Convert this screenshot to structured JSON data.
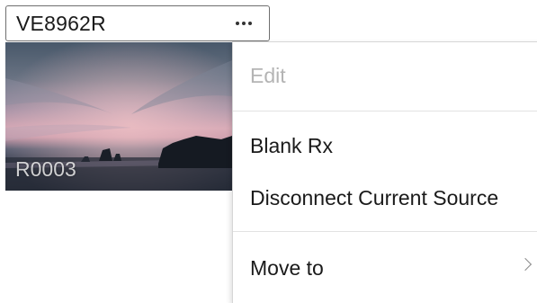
{
  "source_card": {
    "title": "VE8962R",
    "more_icon": "ellipsis-horizontal-icon",
    "preview_label": "R0003"
  },
  "context_menu": {
    "items": [
      {
        "label": "Edit",
        "enabled": false
      },
      {
        "label": "Blank Rx",
        "enabled": true
      },
      {
        "label": "Disconnect Current Source",
        "enabled": true
      },
      {
        "label": "Move to",
        "enabled": true,
        "submenu_icon": "chevron-right-icon"
      }
    ]
  }
}
